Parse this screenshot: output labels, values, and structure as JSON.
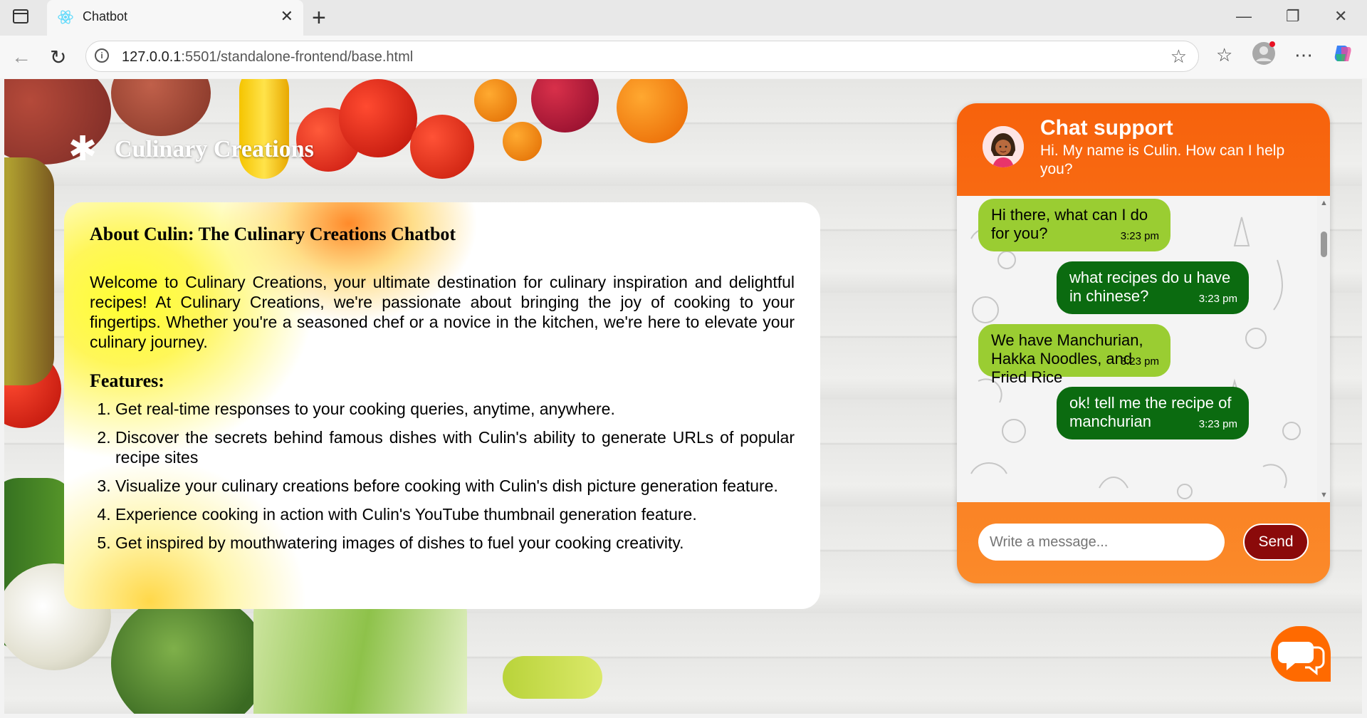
{
  "browser": {
    "tab_title": "Chatbot",
    "tab_close": "✕",
    "new_tab": "+",
    "url_host": "127.0.0.1",
    "url_rest": ":5501/standalone-frontend/base.html",
    "window_minimize": "—",
    "window_restore": "❐",
    "window_close": "✕"
  },
  "page": {
    "brand_name": "Culinary Creations",
    "about": {
      "heading": "About Culin: The Culinary Creations Chatbot",
      "intro": "Welcome to Culinary Creations, your ultimate destination for culinary inspiration and delightful recipes! At Culinary Creations, we're passionate about bringing the joy of cooking to your fingertips. Whether you're a seasoned chef or a novice in the kitchen, we're here to elevate your culinary journey.",
      "features_heading": "Features:",
      "features": [
        "Get real-time responses to your cooking queries, anytime, anywhere.",
        "Discover the secrets behind famous dishes with Culin's ability to generate URLs of popular recipe sites",
        "Visualize your culinary creations before cooking with Culin's dish picture generation feature.",
        "Experience cooking in action with Culin's YouTube thumbnail generation feature.",
        "Get inspired by mouthwatering images of dishes to fuel your cooking creativity."
      ]
    }
  },
  "chat": {
    "title": "Chat support",
    "subtitle": "Hi. My name is Culin. How can I help you?",
    "messages": [
      {
        "from": "bot",
        "text": "Hi there, what can I do for you?",
        "time": "3:23 pm"
      },
      {
        "from": "user",
        "text": "what recipes do u have in chinese?",
        "time": "3:23 pm"
      },
      {
        "from": "bot",
        "text": "We have Manchurian, Hakka Noodles, and Fried Rice",
        "time": "3:23 pm"
      },
      {
        "from": "user",
        "text": "ok! tell me the recipe of manchurian",
        "time": "3:23 pm"
      }
    ],
    "input_placeholder": "Write a message...",
    "send_label": "Send"
  },
  "colors": {
    "chat_header": "#f7620c",
    "bot_bubble": "#9acd32",
    "user_bubble": "#0b6b10",
    "send_button": "#8b0a0a",
    "fab": "#ff6a00"
  }
}
